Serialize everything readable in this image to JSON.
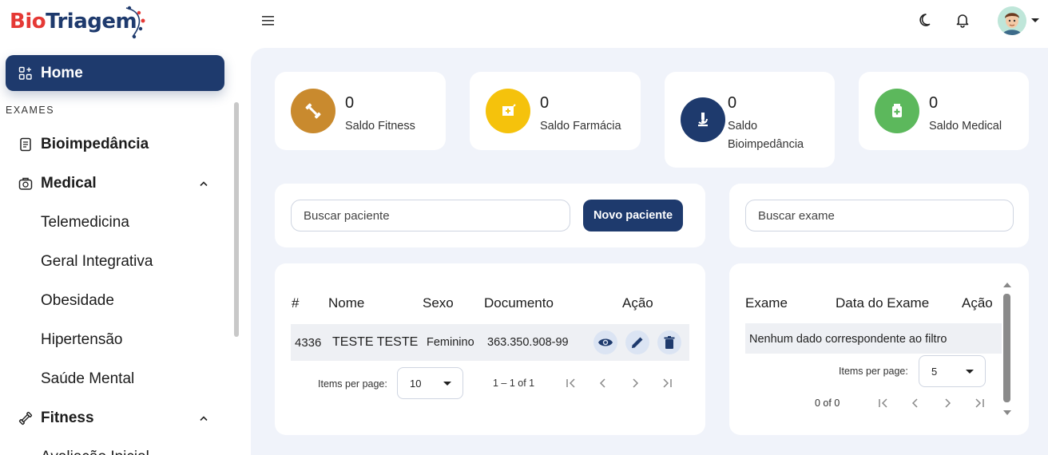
{
  "brand": {
    "part1": "Bio",
    "part2": "Triagem"
  },
  "header": {
    "menu_icon": "menu-icon",
    "theme_icon": "moon-icon",
    "notification_icon": "bell-icon",
    "avatar_icon": "user-avatar"
  },
  "sidebar": {
    "home": "Home",
    "section": "EXAMES",
    "items": [
      {
        "label": "Bioimpedância",
        "icon": "document-icon",
        "parent": true
      },
      {
        "label": "Medical",
        "icon": "medical-bag-icon",
        "parent": true,
        "expanded": true
      },
      {
        "label": "Telemedicina"
      },
      {
        "label": "Geral Integrativa"
      },
      {
        "label": "Obesidade"
      },
      {
        "label": "Hipertensão"
      },
      {
        "label": "Saúde Mental"
      },
      {
        "label": "Fitness",
        "icon": "dumbbell-icon",
        "parent": true,
        "expanded": true
      },
      {
        "label": "Avaliação Inicial"
      }
    ]
  },
  "stats": [
    {
      "value": "0",
      "label": "Saldo Fitness",
      "color": "#c98a2e",
      "icon": "dumbbell-icon"
    },
    {
      "value": "0",
      "label": "Saldo Farmácia",
      "color": "#f5c20c",
      "icon": "pharmacy-icon"
    },
    {
      "value": "0",
      "label": "Saldo Bioimpedância",
      "label_line1": "Saldo",
      "label_line2": "Bioimpedância",
      "color": "#1e3a6d",
      "icon": "microscope-icon"
    },
    {
      "value": "0",
      "label": "Saldo Medical",
      "color": "#5cb85c",
      "icon": "medical-kit-icon"
    }
  ],
  "patients": {
    "search_placeholder": "Buscar paciente",
    "new_button": "Novo paciente",
    "columns": [
      "#",
      "Nome",
      "Sexo",
      "Documento",
      "Ação"
    ],
    "rows": [
      {
        "id": "4336",
        "name": "TESTE TESTE",
        "sex": "Feminino",
        "document": "363.350.908-99"
      }
    ],
    "items_per_page_label": "Items per page:",
    "items_per_page": "10",
    "range": "1 – 1 of 1"
  },
  "exams": {
    "search_placeholder": "Buscar exame",
    "columns": [
      "Exame",
      "Data do Exame",
      "Ação"
    ],
    "empty": "Nenhum dado correspondente ao filtro",
    "items_per_page_label": "Items per page:",
    "items_per_page": "5",
    "range": "0 of 0"
  },
  "colors": {
    "primary": "#1e3a6d",
    "accent_red": "#e53935",
    "action_bg": "#dbe4f3",
    "main_bg": "#f0f3fa"
  }
}
